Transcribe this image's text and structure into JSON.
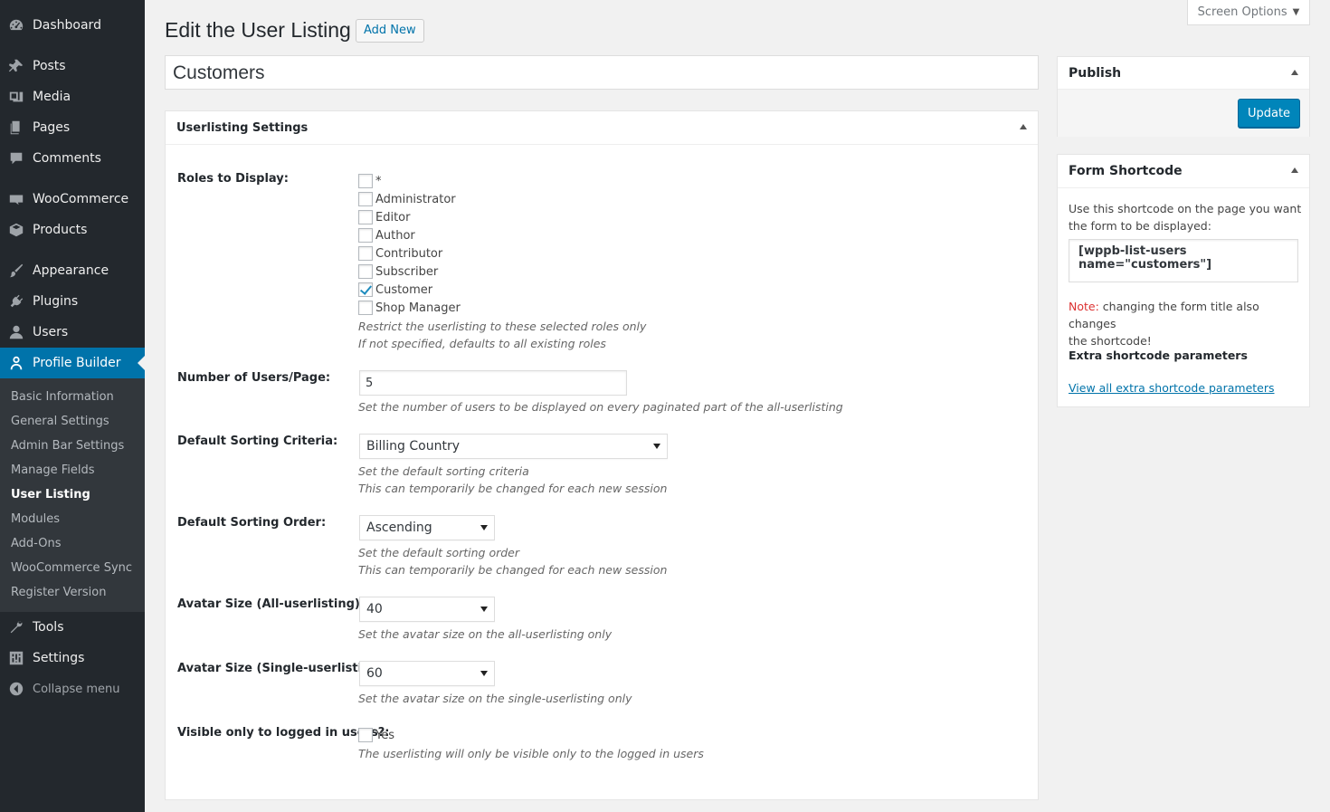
{
  "sidebar": {
    "items": [
      {
        "label": "Dashboard",
        "icon": "dashboard-icon"
      },
      {
        "label": "Posts",
        "icon": "pin-icon"
      },
      {
        "label": "Media",
        "icon": "media-icon"
      },
      {
        "label": "Pages",
        "icon": "pages-icon"
      },
      {
        "label": "Comments",
        "icon": "comment-icon"
      },
      {
        "label": "WooCommerce",
        "icon": "woocommerce-icon"
      },
      {
        "label": "Products",
        "icon": "box-icon"
      },
      {
        "label": "Appearance",
        "icon": "brush-icon"
      },
      {
        "label": "Plugins",
        "icon": "plug-icon"
      },
      {
        "label": "Users",
        "icon": "user-icon"
      },
      {
        "label": "Profile Builder",
        "icon": "user-outline-icon"
      },
      {
        "label": "Tools",
        "icon": "wrench-icon"
      },
      {
        "label": "Settings",
        "icon": "sliders-icon"
      }
    ],
    "submenu": [
      "Basic Information",
      "General Settings",
      "Admin Bar Settings",
      "Manage Fields",
      "User Listing",
      "Modules",
      "Add-Ons",
      "WooCommerce Sync",
      "Register Version"
    ],
    "collapse_label": "Collapse menu"
  },
  "header": {
    "title": "Edit the User Listing",
    "add_new": "Add New",
    "screen_options": "Screen Options"
  },
  "post_title": "Customers",
  "settings": {
    "box_title": "Userlisting Settings",
    "roles_label": "Roles to Display:",
    "roles": [
      {
        "name": "*",
        "checked": false
      },
      {
        "name": "Administrator",
        "checked": false
      },
      {
        "name": "Editor",
        "checked": false
      },
      {
        "name": "Author",
        "checked": false
      },
      {
        "name": "Contributor",
        "checked": false
      },
      {
        "name": "Subscriber",
        "checked": false
      },
      {
        "name": "Customer",
        "checked": true
      },
      {
        "name": "Shop Manager",
        "checked": false
      }
    ],
    "roles_desc1": "Restrict the userlisting to these selected roles only",
    "roles_desc2": "If not specified, defaults to all existing roles",
    "users_per_page_label": "Number of Users/Page:",
    "users_per_page_value": "5",
    "users_per_page_desc": "Set the number of users to be displayed on every paginated part of the all-userlisting",
    "sort_criteria_label": "Default Sorting Criteria:",
    "sort_criteria_value": "Billing Country",
    "sort_criteria_desc1": "Set the default sorting criteria",
    "sort_criteria_desc2": "This can temporarily be changed for each new session",
    "sort_order_label": "Default Sorting Order:",
    "sort_order_value": "Ascending",
    "sort_order_desc1": "Set the default sorting order",
    "sort_order_desc2": "This can temporarily be changed for each new session",
    "avatar_all_label": "Avatar Size (All-userlisting):",
    "avatar_all_value": "40",
    "avatar_all_desc": "Set the avatar size on the all-userlisting only",
    "avatar_single_label": "Avatar Size (Single-userlisting):",
    "avatar_single_value": "60",
    "avatar_single_desc": "Set the avatar size on the single-userlisting only",
    "visible_label": "Visible only to logged in users?:",
    "visible_option": "Yes",
    "visible_checked": false,
    "visible_desc": "The userlisting will only be visible only to the logged in users"
  },
  "publish": {
    "title": "Publish",
    "update": "Update"
  },
  "form_shortcode": {
    "title": "Form Shortcode",
    "intro_line1": "Use this shortcode on the page you want",
    "intro_line2": "the form to be displayed:",
    "shortcode": "[wppb-list-users name=\"customers\"]",
    "note_label": "Note:",
    "note_line1": " changing the form title also changes",
    "note_line2": "the shortcode!",
    "extra_title": "Extra shortcode parameters",
    "extra_link": "View all extra shortcode parameters"
  },
  "colors": {
    "admin_bar": "#23282d",
    "accent": "#0073aa",
    "button_primary": "#0085ba",
    "note_red": "#dc3232"
  }
}
